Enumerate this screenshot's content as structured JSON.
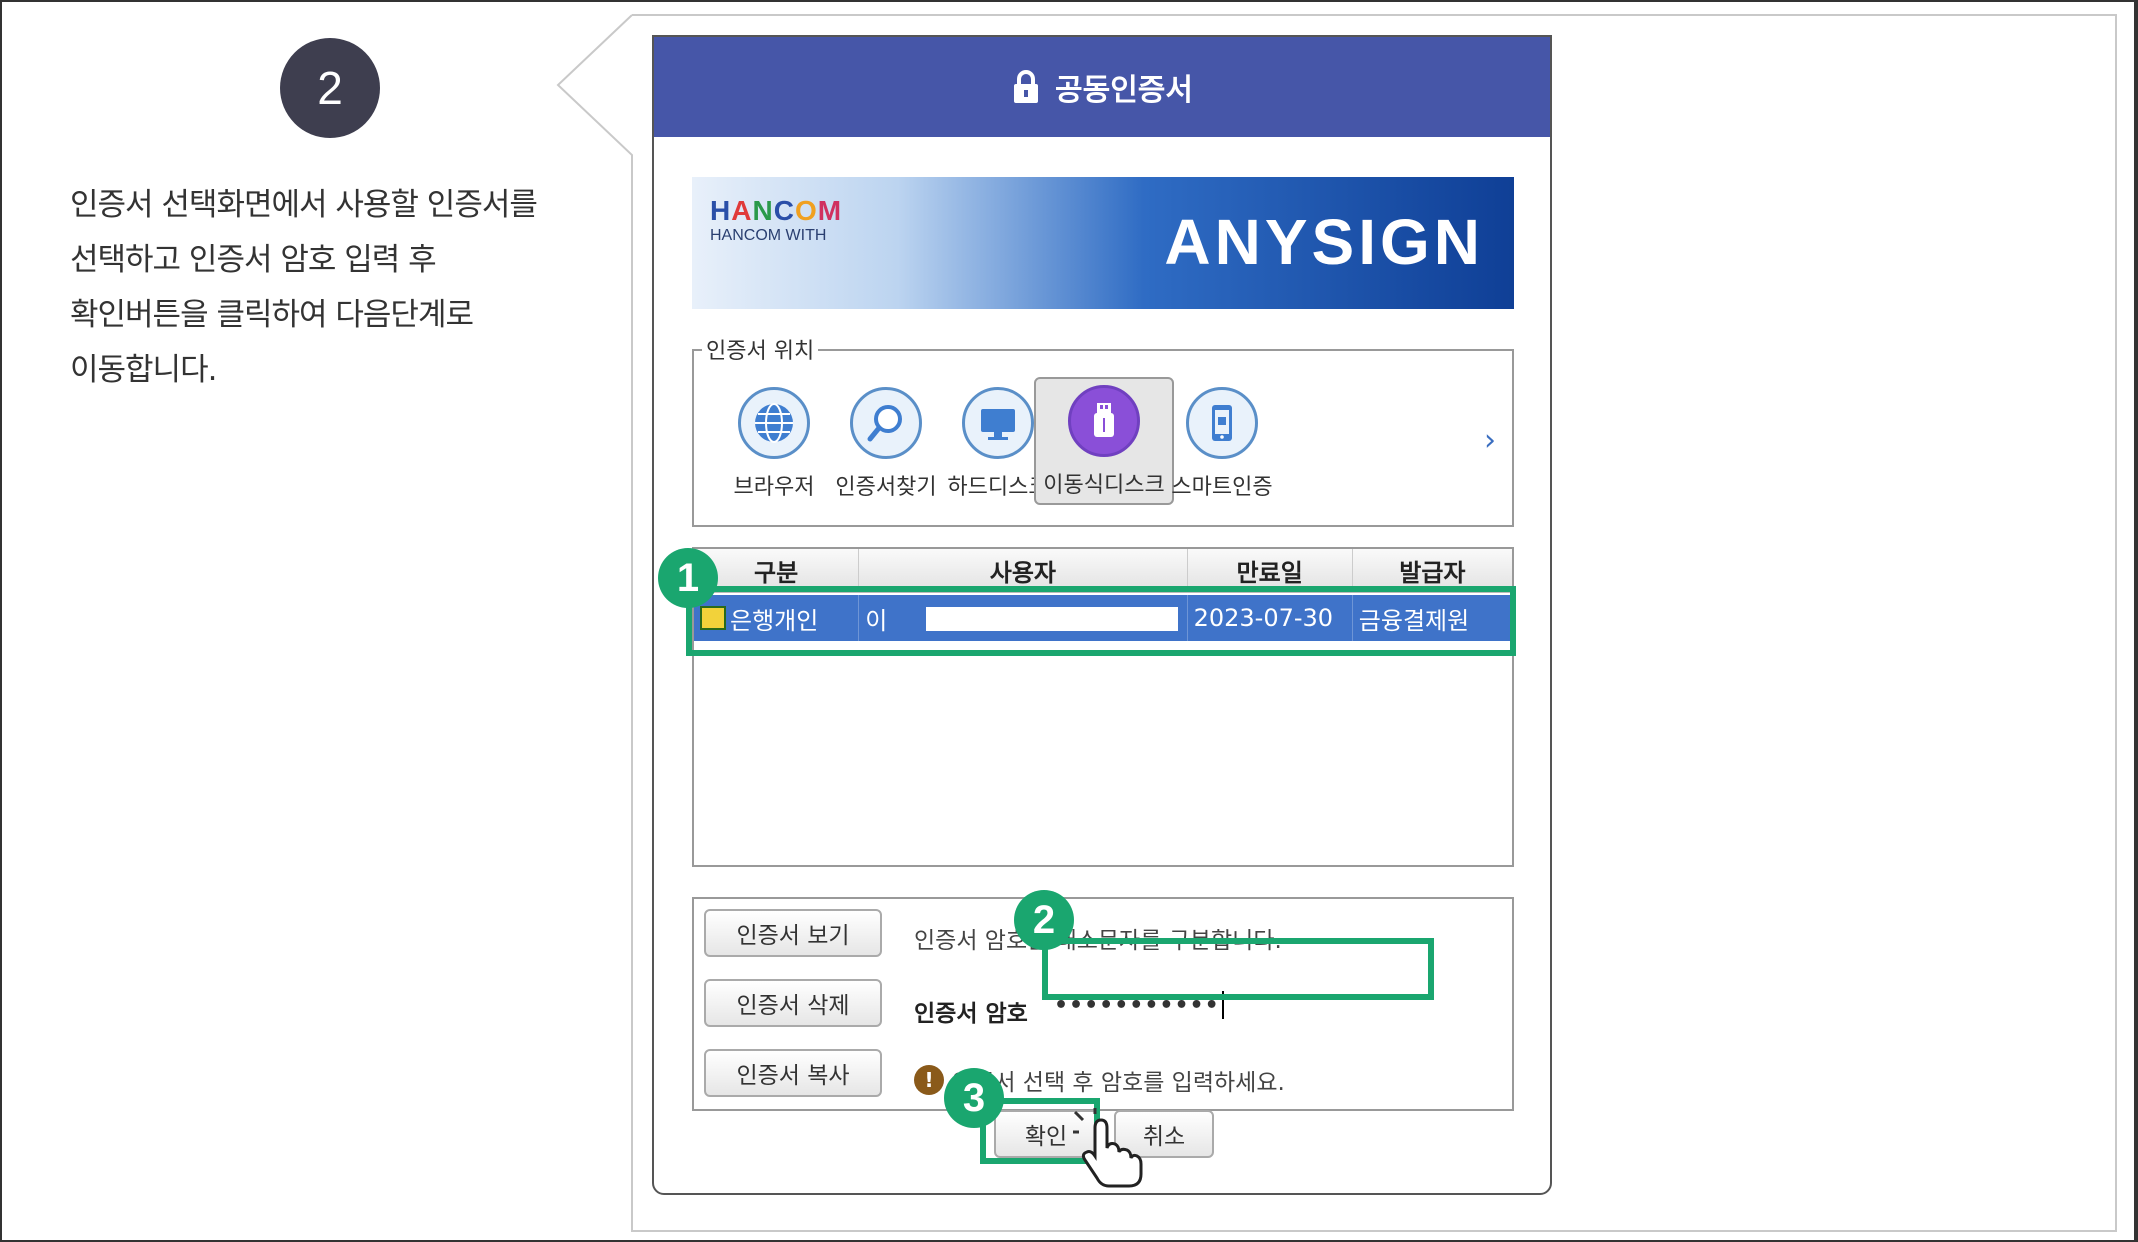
{
  "step": {
    "number": "2"
  },
  "description": {
    "lines": [
      "인증서 선택화면에서 사용할 인증서를",
      "선택하고 인증서 암호 입력 후",
      "확인버튼을 클릭하여 다음단계로",
      "이동합니다."
    ]
  },
  "dialog": {
    "title": "공동인증서",
    "banner": {
      "logo": "HANCOM",
      "logo_sub": "HANCOM WITH",
      "product": "ANYSIGN"
    },
    "location": {
      "legend": "인증서 위치",
      "items": [
        {
          "label": "브라우저",
          "icon": "globe-icon"
        },
        {
          "label": "인증서찾기",
          "icon": "search-icon"
        },
        {
          "label": "하드디스크",
          "icon": "monitor-icon"
        },
        {
          "label": "이동식디스크",
          "icon": "usb-icon"
        },
        {
          "label": "스마트인증",
          "icon": "smartphone-icon"
        }
      ],
      "selected_index": 3
    },
    "table": {
      "headers": [
        "구분",
        "사용자",
        "만료일",
        "발급자"
      ],
      "rows": [
        {
          "type": "은행개인",
          "user": "이",
          "expiry": "2023-07-30",
          "issuer": "금융결제원"
        }
      ]
    },
    "buttons": {
      "view": "인증서 보기",
      "delete": "인증서 삭제",
      "copy": "인증서 복사",
      "ok": "확인",
      "cancel": "취소"
    },
    "password": {
      "hint": "인증서 암호는 대소문자를 구분합니다.",
      "label": "인증서 암호",
      "value": "•••••••••••",
      "warning": "인증서 선택 후 암호를 입력하세요."
    }
  },
  "annotations": {
    "badge1": "1",
    "badge2": "2",
    "badge3": "3"
  },
  "colors": {
    "title_bar": "#4656a8",
    "highlight": "#1aa66f",
    "selected_row": "#3f73c9",
    "step_circle": "#3e3e4f"
  }
}
